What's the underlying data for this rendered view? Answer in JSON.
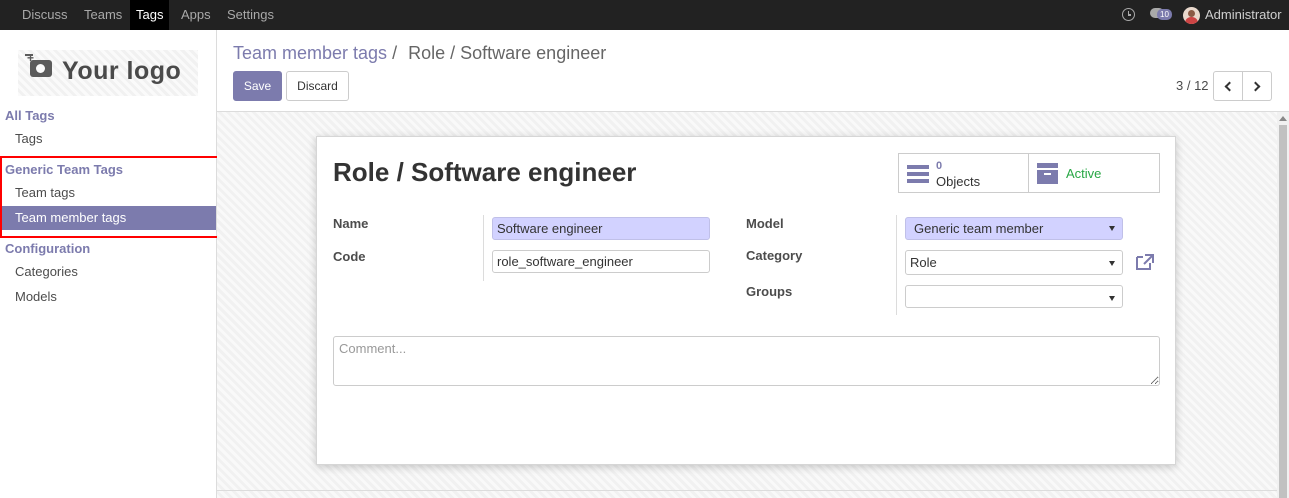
{
  "navbar": {
    "menu": [
      {
        "label": "Discuss",
        "active": false
      },
      {
        "label": "Teams",
        "active": false
      },
      {
        "label": "Tags",
        "active": true
      },
      {
        "label": "Apps",
        "active": false
      },
      {
        "label": "Settings",
        "active": false
      }
    ],
    "chat_badge": "10",
    "user": "Administrator"
  },
  "sidebar": {
    "logo_text": "Your logo",
    "sections": [
      {
        "header": "All Tags",
        "items": [
          {
            "label": "Tags",
            "active": false
          }
        ]
      },
      {
        "header": "Generic Team Tags",
        "items": [
          {
            "label": "Team tags",
            "active": false
          },
          {
            "label": "Team member tags",
            "active": true
          }
        ]
      },
      {
        "header": "Configuration",
        "items": [
          {
            "label": "Categories",
            "active": false
          },
          {
            "label": "Models",
            "active": false
          }
        ]
      }
    ]
  },
  "control_panel": {
    "breadcrumb_link": "Team member tags",
    "breadcrumb_sep": "/",
    "breadcrumb_current": "Role / Software engineer",
    "save_label": "Save",
    "discard_label": "Discard",
    "pager": "3 / 12"
  },
  "form": {
    "title": "Role / Software engineer",
    "smart_buttons": {
      "objects_count": "0",
      "objects_label": "Objects",
      "active_label": "Active"
    },
    "fields": {
      "name_label": "Name",
      "name_value": "Software engineer",
      "code_label": "Code",
      "code_value": "role_software_engineer",
      "model_label": "Model",
      "model_value": "Generic team member",
      "category_label": "Category",
      "category_value": "Role",
      "groups_label": "Groups",
      "groups_value": ""
    },
    "comment_placeholder": "Comment..."
  },
  "colors": {
    "brand": "#7c7bad",
    "navbar": "#222222",
    "required_field": "#d2d2ff",
    "active_status": "#28a745",
    "highlight_box": "#ff0000"
  }
}
